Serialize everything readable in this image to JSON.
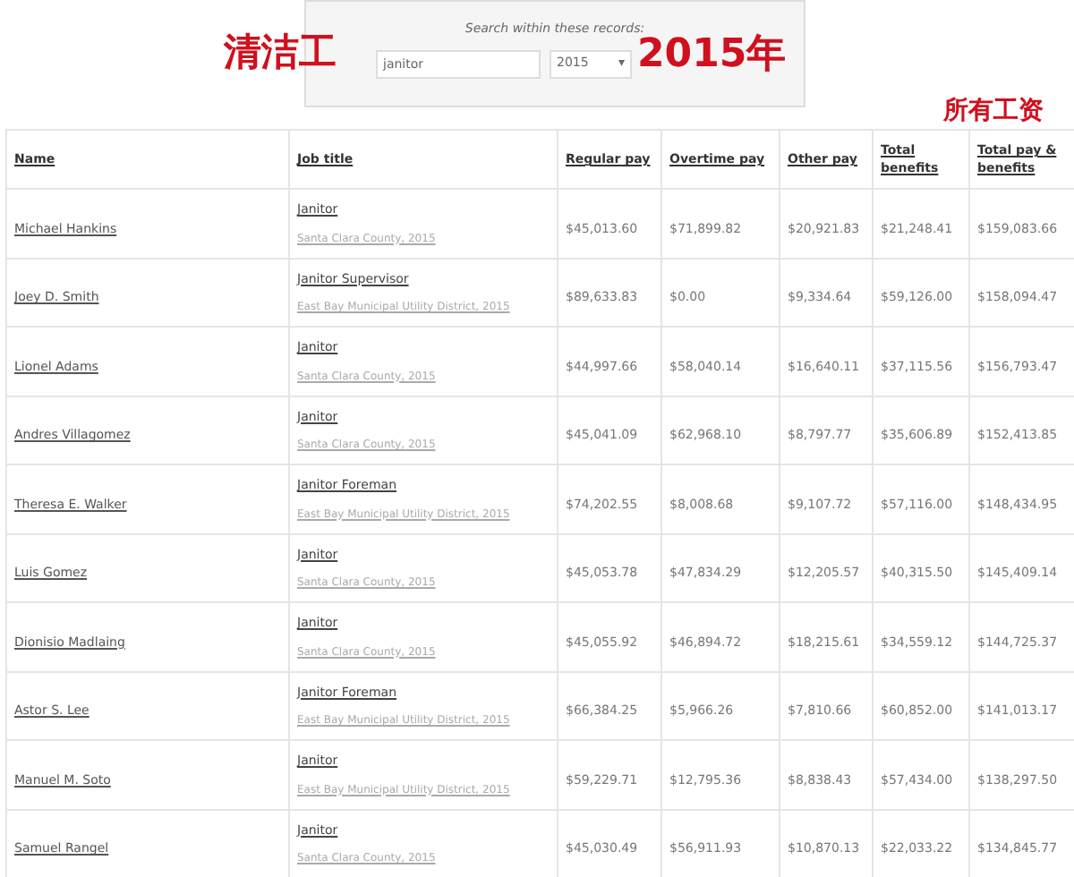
{
  "search": {
    "prompt": "Search within these records:",
    "query": "janitor",
    "year": "2015",
    "year_caret": "▾"
  },
  "annotations": [
    "清洁工",
    "2015年",
    "所有工资"
  ],
  "table": {
    "columns": [
      "Name",
      "Job title",
      "Regular pay",
      "Overtime pay",
      "Other pay",
      "Total benefits",
      "Total pay & benefits"
    ],
    "rows": [
      {
        "name": "Michael Hankins",
        "job_title": {
          "title": "Janitor",
          "employer": "Santa Clara County, 2015"
        },
        "regular_pay": "$45,013.60",
        "overtime_pay": "$71,899.82",
        "other_pay": "$20,921.83",
        "total_benefits": "$21,248.41",
        "total_pay_and_benefits": "$159,083.66"
      },
      {
        "name": "Joey D. Smith",
        "job_title": {
          "title": "Janitor Supervisor",
          "employer": "East Bay Municipal Utility District, 2015"
        },
        "regular_pay": "$89,633.83",
        "overtime_pay": "$0.00",
        "other_pay": "$9,334.64",
        "total_benefits": "$59,126.00",
        "total_pay_and_benefits": "$158,094.47"
      },
      {
        "name": "Lionel Adams",
        "job_title": {
          "title": "Janitor",
          "employer": "Santa Clara County, 2015"
        },
        "regular_pay": "$44,997.66",
        "overtime_pay": "$58,040.14",
        "other_pay": "$16,640.11",
        "total_benefits": "$37,115.56",
        "total_pay_and_benefits": "$156,793.47"
      },
      {
        "name": "Andres Villagomez",
        "job_title": {
          "title": "Janitor",
          "employer": "Santa Clara County, 2015"
        },
        "regular_pay": "$45,041.09",
        "overtime_pay": "$62,968.10",
        "other_pay": "$8,797.77",
        "total_benefits": "$35,606.89",
        "total_pay_and_benefits": "$152,413.85"
      },
      {
        "name": "Theresa E. Walker",
        "job_title": {
          "title": "Janitor Foreman",
          "employer": "East Bay Municipal Utility District, 2015"
        },
        "regular_pay": "$74,202.55",
        "overtime_pay": "$8,008.68",
        "other_pay": "$9,107.72",
        "total_benefits": "$57,116.00",
        "total_pay_and_benefits": "$148,434.95"
      },
      {
        "name": "Luis Gomez",
        "job_title": {
          "title": "Janitor",
          "employer": "Santa Clara County, 2015"
        },
        "regular_pay": "$45,053.78",
        "overtime_pay": "$47,834.29",
        "other_pay": "$12,205.57",
        "total_benefits": "$40,315.50",
        "total_pay_and_benefits": "$145,409.14"
      },
      {
        "name": "Dionisio Madlaing",
        "job_title": {
          "title": "Janitor",
          "employer": "Santa Clara County, 2015"
        },
        "regular_pay": "$45,055.92",
        "overtime_pay": "$46,894.72",
        "other_pay": "$18,215.61",
        "total_benefits": "$34,559.12",
        "total_pay_and_benefits": "$144,725.37"
      },
      {
        "name": "Astor S. Lee",
        "job_title": {
          "title": "Janitor Foreman",
          "employer": "East Bay Municipal Utility District, 2015"
        },
        "regular_pay": "$66,384.25",
        "overtime_pay": "$5,966.26",
        "other_pay": "$7,810.66",
        "total_benefits": "$60,852.00",
        "total_pay_and_benefits": "$141,013.17"
      },
      {
        "name": "Manuel M. Soto",
        "job_title": {
          "title": "Janitor",
          "employer": "East Bay Municipal Utility District, 2015"
        },
        "regular_pay": "$59,229.71",
        "overtime_pay": "$12,795.36",
        "other_pay": "$8,838.43",
        "total_benefits": "$57,434.00",
        "total_pay_and_benefits": "$138,297.50"
      },
      {
        "name": "Samuel Rangel",
        "job_title": {
          "title": "Janitor",
          "employer": "Santa Clara County, 2015"
        },
        "regular_pay": "$45,030.49",
        "overtime_pay": "$56,911.93",
        "other_pay": "$10,870.13",
        "total_benefits": "$22,033.22",
        "total_pay_and_benefits": "$134,845.77"
      }
    ]
  }
}
